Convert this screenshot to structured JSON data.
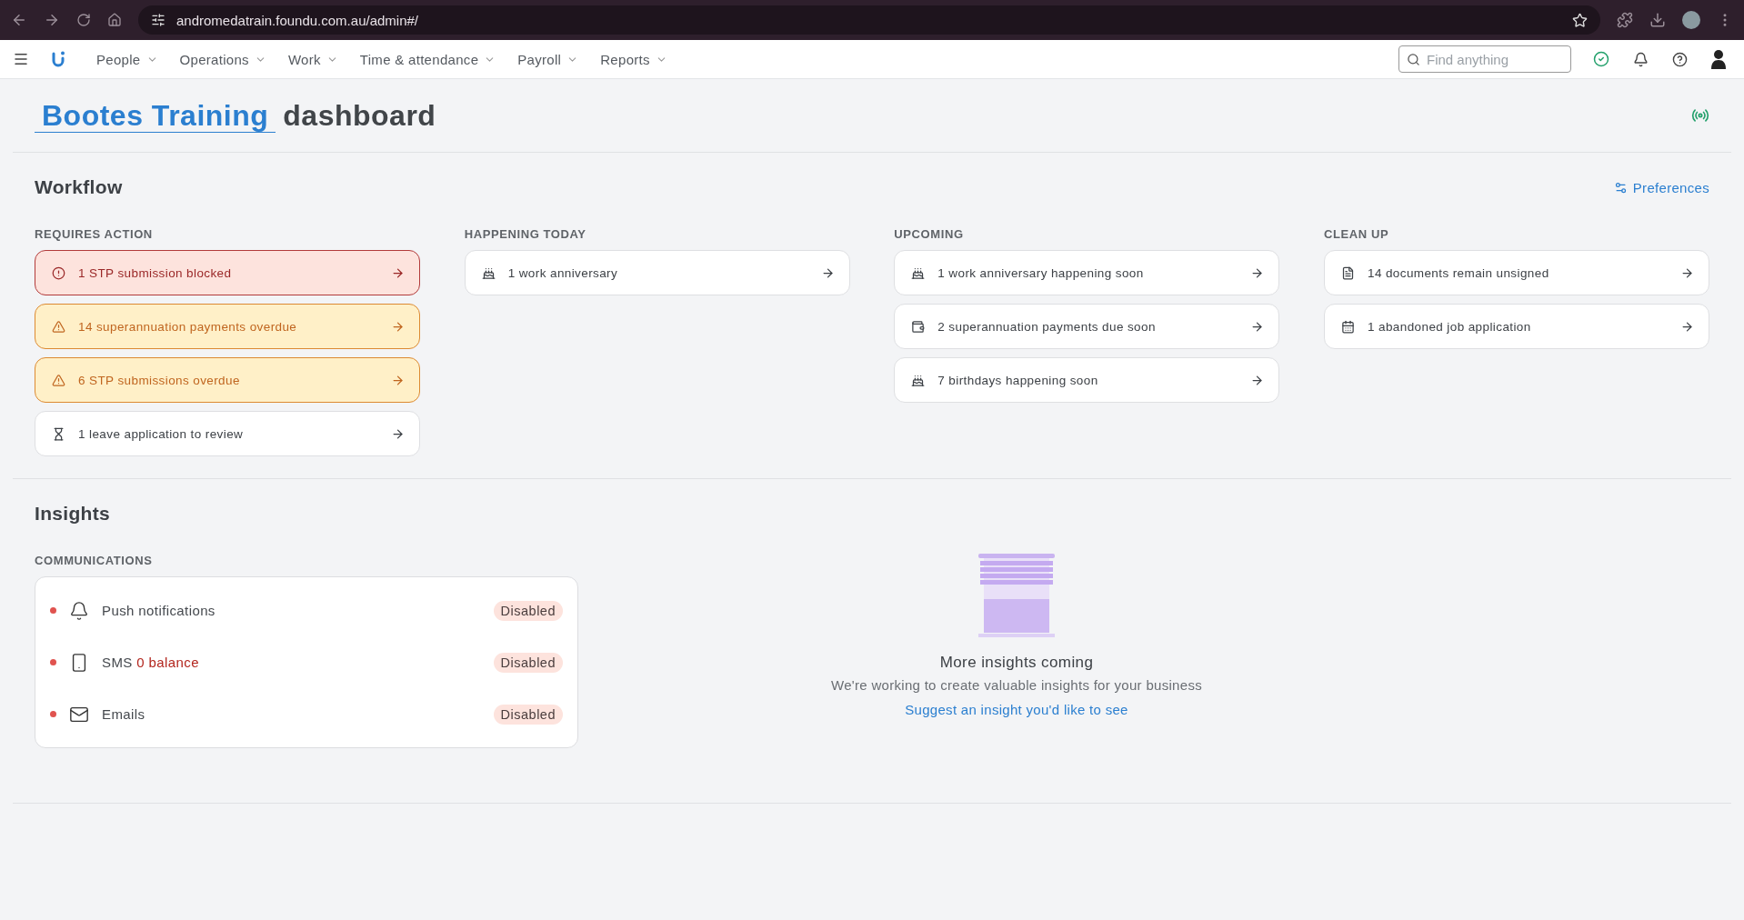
{
  "browser": {
    "url": "andromedatrain.foundu.com.au/admin#/"
  },
  "nav": {
    "items": [
      "People",
      "Operations",
      "Work",
      "Time & attendance",
      "Payroll",
      "Reports"
    ],
    "search": {
      "placeholder": "Find anything"
    }
  },
  "header": {
    "company": "Bootes Training",
    "title": "dashboard"
  },
  "workflow": {
    "title": "Workflow",
    "preferences": "Preferences",
    "columns": [
      {
        "heading": "REQUIRES ACTION",
        "cards": [
          {
            "kind": "blocked",
            "text": "1 STP submission blocked"
          },
          {
            "kind": "overdue",
            "text": "14 superannuation payments overdue"
          },
          {
            "kind": "overdue",
            "text": "6 STP submissions overdue"
          },
          {
            "kind": "review",
            "text": "1 leave application to review"
          }
        ]
      },
      {
        "heading": "HAPPENING TODAY",
        "cards": [
          {
            "kind": "celebration",
            "text": "1 work anniversary"
          }
        ]
      },
      {
        "heading": "UPCOMING",
        "cards": [
          {
            "kind": "celebration",
            "text": "1 work anniversary happening soon"
          },
          {
            "kind": "payment",
            "text": "2 superannuation payments due soon"
          },
          {
            "kind": "celebration",
            "text": "7 birthdays happening soon"
          }
        ]
      },
      {
        "heading": "CLEAN UP",
        "cards": [
          {
            "kind": "document",
            "text": "14 documents remain unsigned"
          },
          {
            "kind": "application",
            "text": "1 abandoned job application"
          }
        ]
      }
    ]
  },
  "insights": {
    "title": "Insights",
    "communications": {
      "heading": "COMMUNICATIONS",
      "rows": [
        {
          "kind": "push",
          "label": "Push notifications",
          "status": "Disabled"
        },
        {
          "kind": "sms",
          "label": "SMS",
          "note": "0 balance",
          "status": "Disabled"
        },
        {
          "kind": "email",
          "label": "Emails",
          "status": "Disabled"
        }
      ]
    },
    "empty": {
      "title": "More insights coming",
      "text": "We're working to create valuable insights for your business",
      "link": "Suggest an insight you'd like to see"
    }
  }
}
